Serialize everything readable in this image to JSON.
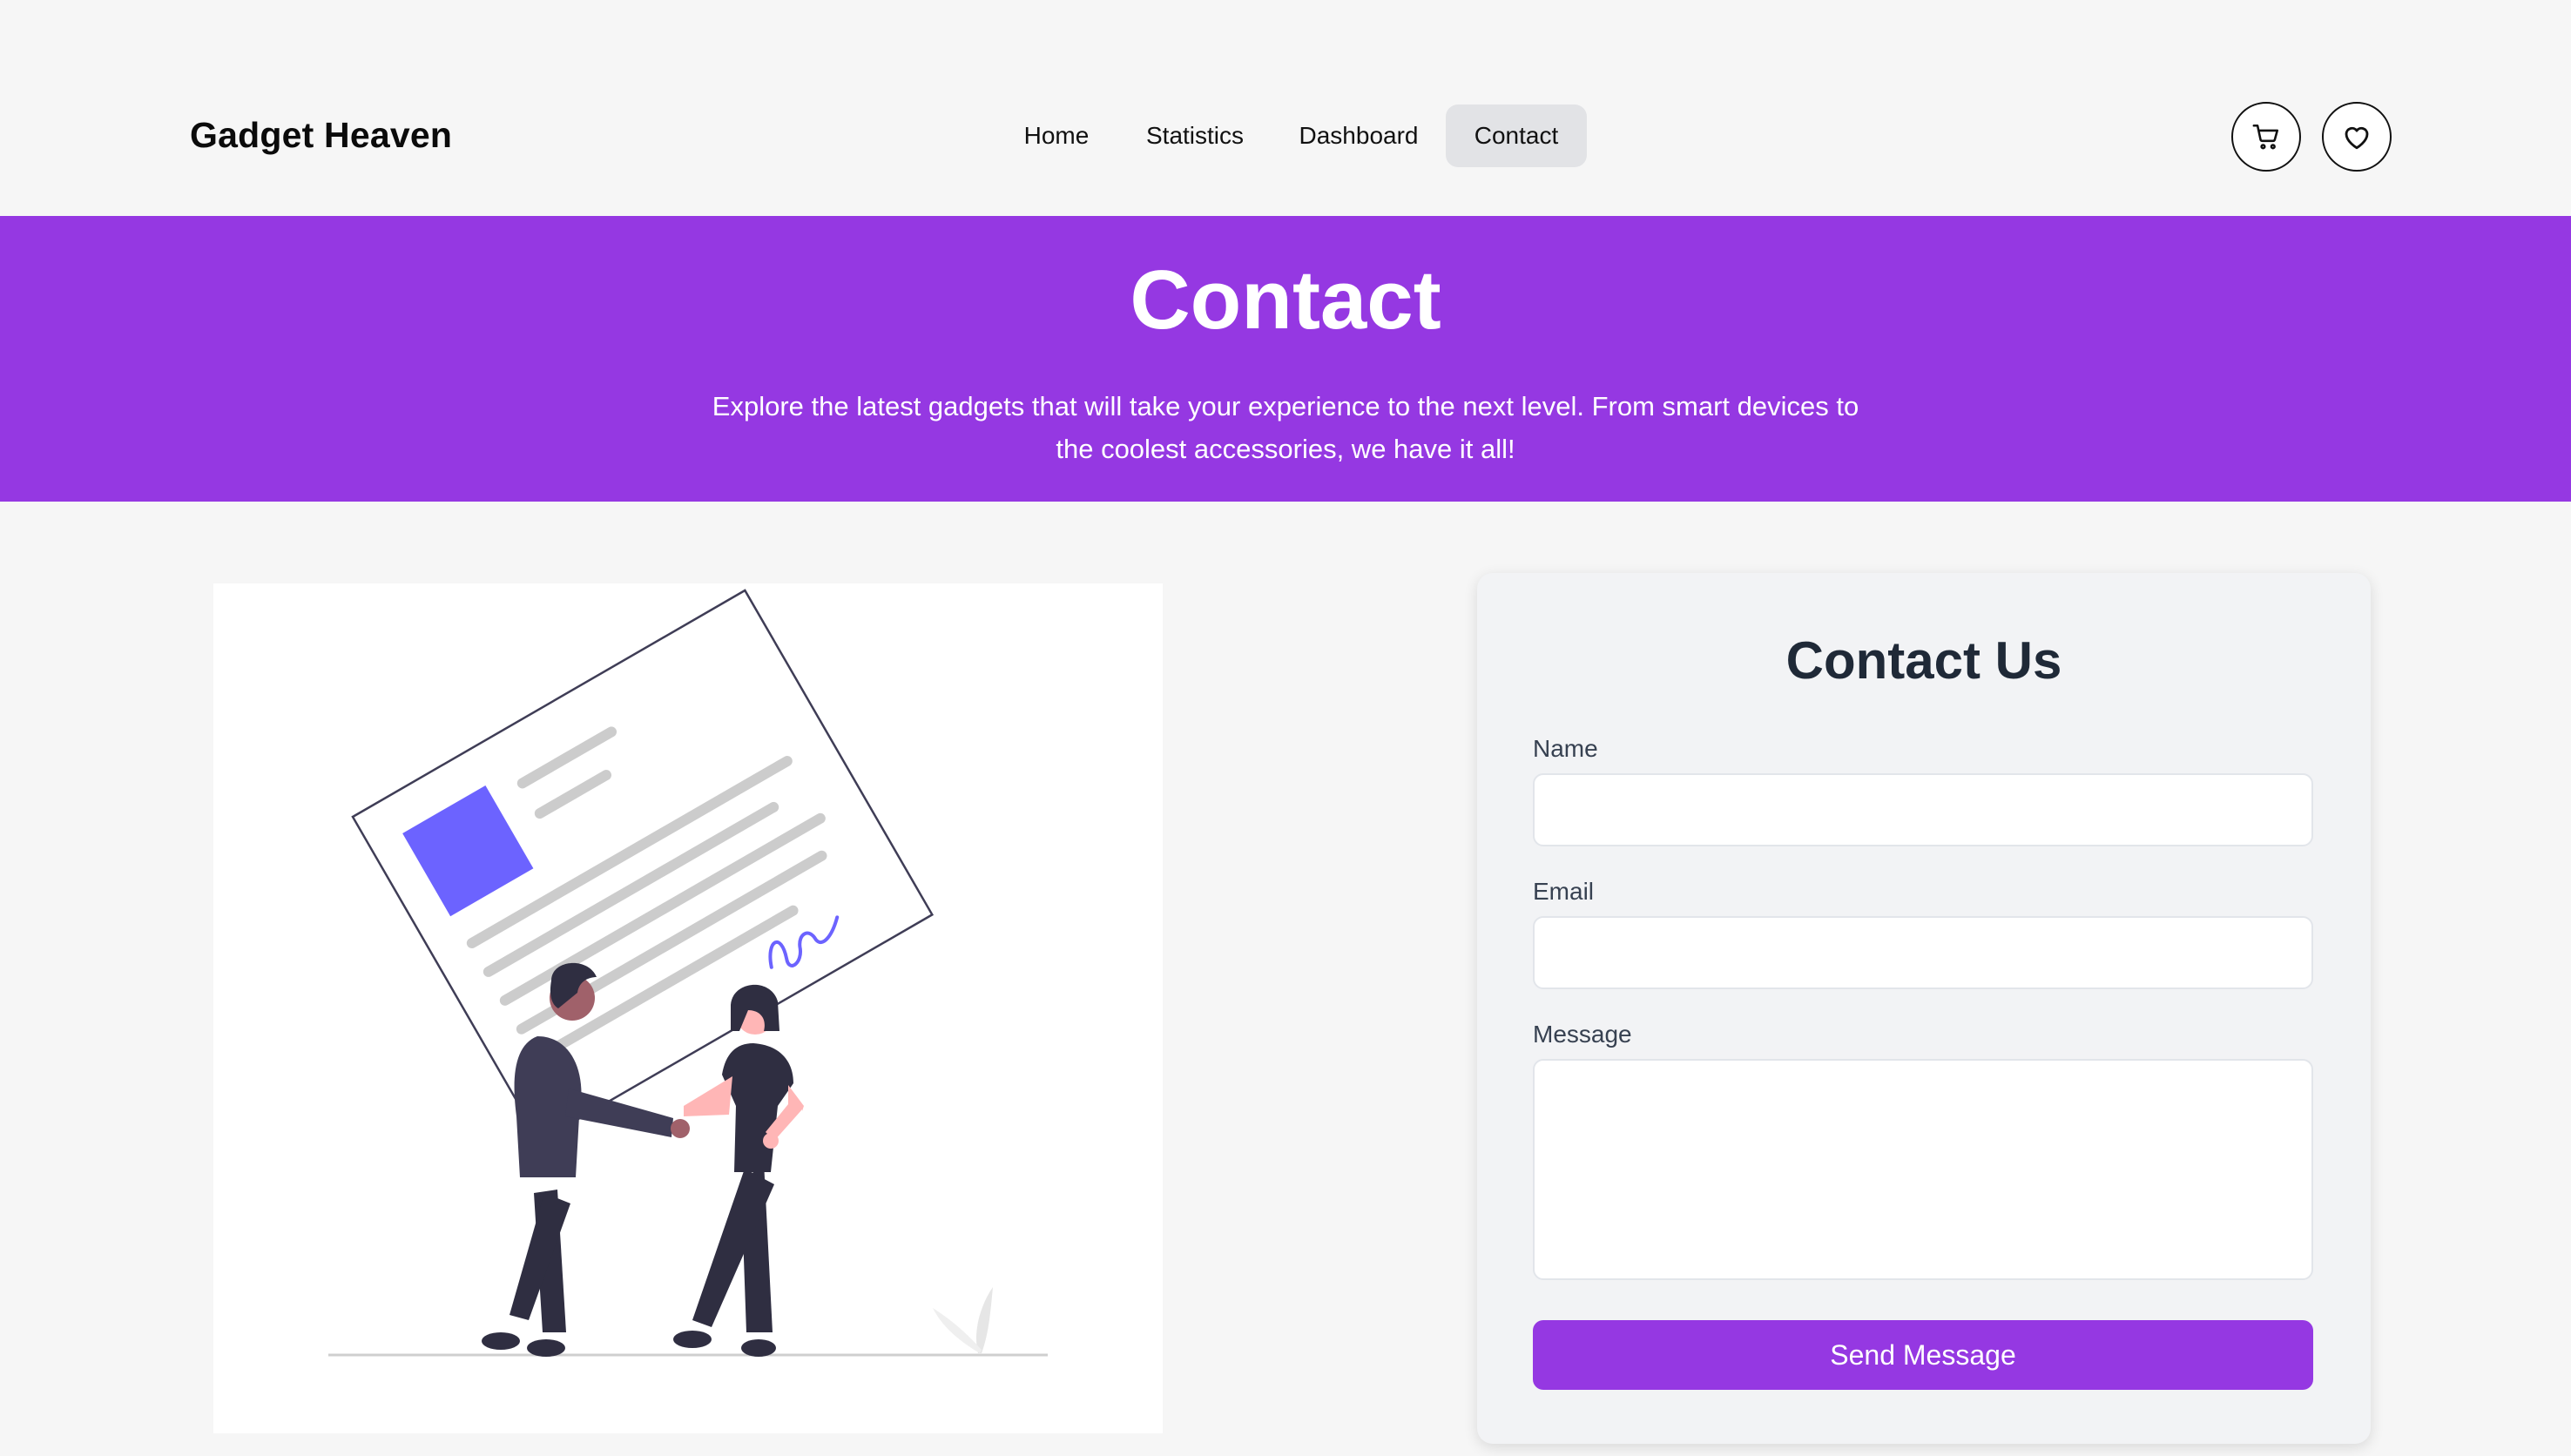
{
  "brand": "Gadget Heaven",
  "nav": {
    "home": "Home",
    "statistics": "Statistics",
    "dashboard": "Dashboard",
    "contact": "Contact",
    "active": "Contact"
  },
  "header_icons": [
    "cart-icon",
    "heart-icon"
  ],
  "hero": {
    "title": "Contact",
    "subtitle": "Explore the latest gadgets that will take your experience to the next level. From smart devices to the coolest accessories, we have it all!"
  },
  "form": {
    "title": "Contact Us",
    "name_label": "Name",
    "name_value": "",
    "email_label": "Email",
    "email_value": "",
    "message_label": "Message",
    "message_value": "",
    "submit_label": "Send Message"
  },
  "colors": {
    "accent": "#9538e2",
    "illustration_accent": "#6c63ff",
    "figure_dark": "#2f2e41",
    "skin": "#ffb6b6"
  }
}
